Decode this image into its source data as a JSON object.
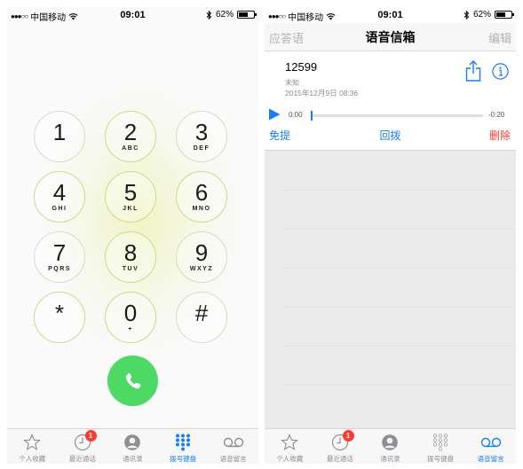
{
  "left_screen": {
    "status_bar": {
      "carrier": "中国移动",
      "time": "09:01",
      "battery_percent": "62%",
      "battery_level": 0.62
    },
    "keypad": {
      "keys": [
        {
          "digit": "1",
          "letters": ""
        },
        {
          "digit": "2",
          "letters": "ABC"
        },
        {
          "digit": "3",
          "letters": "DEF"
        },
        {
          "digit": "4",
          "letters": "GHI"
        },
        {
          "digit": "5",
          "letters": "JKL"
        },
        {
          "digit": "6",
          "letters": "MNO"
        },
        {
          "digit": "7",
          "letters": "PQRS"
        },
        {
          "digit": "8",
          "letters": "TUV"
        },
        {
          "digit": "9",
          "letters": "WXYZ"
        },
        {
          "digit": "*",
          "letters": ""
        },
        {
          "digit": "0",
          "letters": "+"
        },
        {
          "digit": "#",
          "letters": ""
        }
      ],
      "call_icon": "phone-icon"
    },
    "tab_bar": {
      "tabs": [
        {
          "label": "个人收藏",
          "icon": "star-icon",
          "active": false
        },
        {
          "label": "最近通话",
          "icon": "clock-icon",
          "active": false,
          "badge": "1"
        },
        {
          "label": "通讯录",
          "icon": "contact-icon",
          "active": false
        },
        {
          "label": "拨号键盘",
          "icon": "keypad-icon",
          "active": true
        },
        {
          "label": "语音留言",
          "icon": "voicemail-icon",
          "active": false
        }
      ]
    }
  },
  "right_screen": {
    "status_bar": {
      "carrier": "中国移动",
      "time": "09:01",
      "battery_percent": "62%",
      "battery_level": 0.62
    },
    "nav_bar": {
      "left": "应答语",
      "title": "语音信箱",
      "right": "编辑"
    },
    "voicemail": {
      "number": "12599",
      "location": "未知",
      "date": "2015年12月9日 08:36",
      "time_elapsed": "0:00",
      "time_remaining": "-0:20",
      "progress": 0.0,
      "actions": {
        "speaker": "免提",
        "call_back": "回拨",
        "delete": "删除"
      }
    },
    "tab_bar": {
      "tabs": [
        {
          "label": "个人收藏",
          "icon": "star-icon",
          "active": false
        },
        {
          "label": "最近通话",
          "icon": "clock-icon",
          "active": false,
          "badge": "1"
        },
        {
          "label": "通讯录",
          "icon": "contact-icon",
          "active": false
        },
        {
          "label": "拨号键盘",
          "icon": "keypad-icon",
          "active": false
        },
        {
          "label": "语音留言",
          "icon": "voicemail-icon",
          "active": true
        }
      ]
    }
  },
  "colors": {
    "accent_blue": "#147efb",
    "call_green": "#4cd964",
    "delete_red": "#ff3b30",
    "badge_red": "#ff3b30",
    "inactive_gray": "#8e8e93"
  }
}
